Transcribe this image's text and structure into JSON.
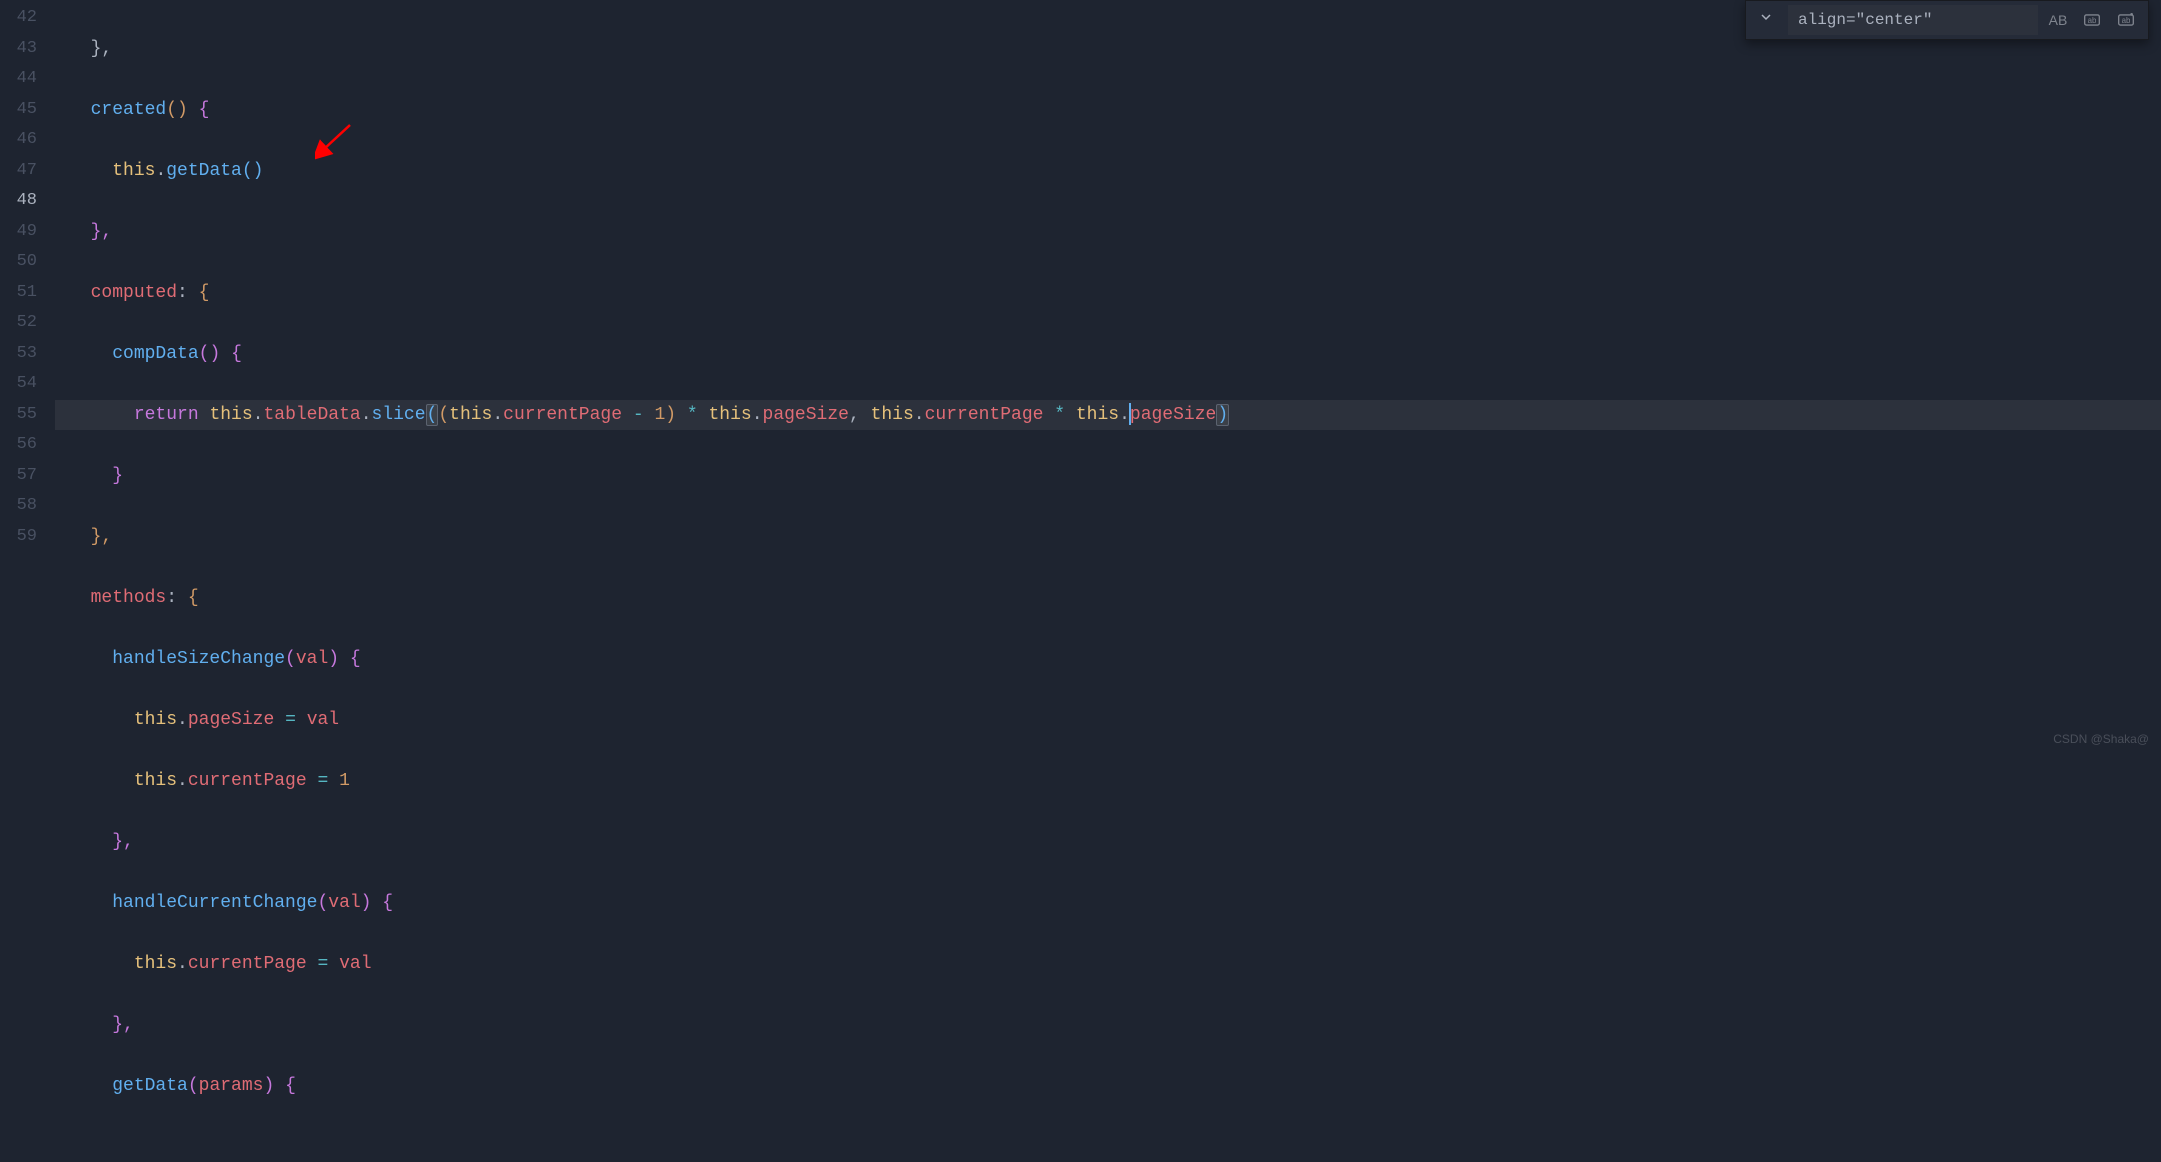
{
  "search": {
    "value": "align=\"center\"",
    "case_label": "AB"
  },
  "watermark": "CSDN @Shaka@",
  "lines": {
    "start": 42,
    "active": 48,
    "l42": "},",
    "l43_fn": "created",
    "l44_this": "this",
    "l44_fn": "getData",
    "l45": "},",
    "l46_key": "computed",
    "l47_fn": "compData",
    "l48_return": "return",
    "l48_this": "this",
    "l48_tableData": "tableData",
    "l48_slice": "slice",
    "l48_currentPage": "currentPage",
    "l48_pageSize": "pageSize",
    "l48_num1": "1",
    "l49": "}",
    "l50": "},",
    "l51_key": "methods",
    "l52_fn": "handleSizeChange",
    "l52_arg": "val",
    "l53_this": "this",
    "l53_pageSize": "pageSize",
    "l53_val": "val",
    "l54_this": "this",
    "l54_currentPage": "currentPage",
    "l54_num1": "1",
    "l55": "},",
    "l56_fn": "handleCurrentChange",
    "l56_arg": "val",
    "l57_this": "this",
    "l57_currentPage": "currentPage",
    "l57_val": "val",
    "l58": "},",
    "l59_fn": "getData",
    "l59_arg": "params"
  }
}
